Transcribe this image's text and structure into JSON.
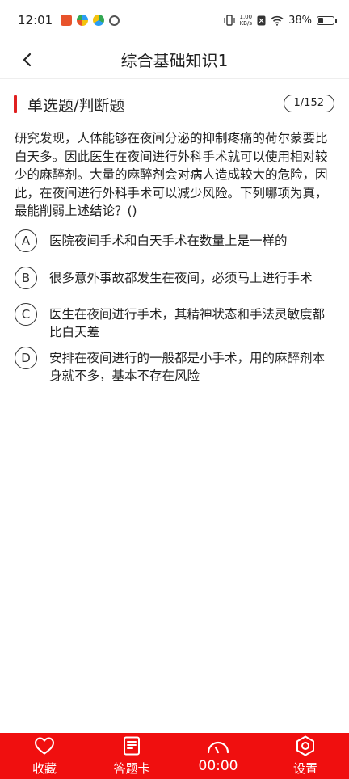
{
  "status_bar": {
    "time": "12:01",
    "net_speed_value": "1.00",
    "net_speed_unit": "KB/s",
    "battery": "38%",
    "battery_level": 0.38
  },
  "nav": {
    "title": "综合基础知识1"
  },
  "section": {
    "title": "单选题/判断题",
    "counter": "1/152"
  },
  "question": {
    "text": "研究发现，人体能够在夜间分泌的抑制疼痛的荷尔蒙要比白天多。因此医生在夜间进行外科手术就可以使用相对较少的麻醉剂。大量的麻醉剂会对病人造成较大的危险，因此，在夜间进行外科手术可以减少风险。下列哪项为真，最能削弱上述结论？()"
  },
  "options": [
    {
      "letter": "A",
      "text": "医院夜间手术和白天手术在数量上是一样的"
    },
    {
      "letter": "B",
      "text": "很多意外事故都发生在夜间，必须马上进行手术"
    },
    {
      "letter": "C",
      "text": "医生在夜间进行手术，其精神状态和手法灵敏度都比白天差"
    },
    {
      "letter": "D",
      "text": "安排在夜间进行的一般都是小手术，用的麻醉剂本身就不多，基本不存在风险"
    }
  ],
  "bottom_bar": {
    "favorite_label": "收藏",
    "answer_card_label": "答题卡",
    "timer": "00:00",
    "settings_label": "设置"
  },
  "colors": {
    "accent": "#f00f0f",
    "section_marker": "#e02020"
  },
  "icons": {
    "favorite": "heart-icon",
    "answer_card": "answer-card-icon",
    "timer": "clock-icon",
    "settings": "gear-icon",
    "back": "chevron-left-icon"
  }
}
